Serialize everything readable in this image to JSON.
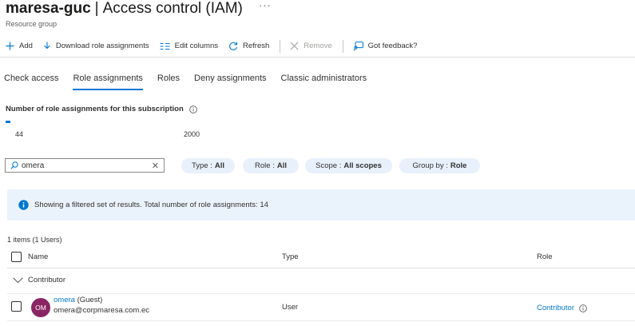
{
  "header": {
    "resource_name": "maresa-guc",
    "separator": "|",
    "page_title": "Access control (IAM)",
    "more_label": "···",
    "subtitle": "Resource group"
  },
  "toolbar": {
    "add_label": "Add",
    "download_label": "Download role assignments",
    "edit_columns_label": "Edit columns",
    "refresh_label": "Refresh",
    "remove_label": "Remove",
    "feedback_label": "Got feedback?"
  },
  "tabs": [
    {
      "label": "Check access",
      "active": false
    },
    {
      "label": "Role assignments",
      "active": true
    },
    {
      "label": "Roles",
      "active": false
    },
    {
      "label": "Deny assignments",
      "active": false
    },
    {
      "label": "Classic administrators",
      "active": false
    }
  ],
  "assignment_count": {
    "title": "Number of role assignments for this subscription",
    "current": "44",
    "limit": "2000",
    "fraction": 0.022
  },
  "search": {
    "value": "omera",
    "clear_label": "✕"
  },
  "filters": [
    {
      "label": "Type :",
      "value": "All"
    },
    {
      "label": "Role :",
      "value": "All"
    },
    {
      "label": "Scope :",
      "value": "All scopes"
    },
    {
      "label": "Group by :",
      "value": "Role"
    }
  ],
  "banner": {
    "text": "Showing a filtered set of results. Total number of role assignments: 14"
  },
  "table": {
    "items_count": "1 items (1 Users)",
    "columns": {
      "name": "Name",
      "type": "Type",
      "role": "Role"
    },
    "group_label": "Contributor",
    "rows": [
      {
        "initials": "OM",
        "name": "omera",
        "qualifier": "(Guest)",
        "email": "omera@corpmaresa.com.ec",
        "type": "User",
        "role": "Contributor"
      }
    ]
  },
  "colors": {
    "accent": "#0078d4",
    "avatar": "#8a2563",
    "pill_bg": "#e8f0fb",
    "banner_bg": "#eaf3fc"
  },
  "icons": [
    "plus-icon",
    "download-icon",
    "columns-icon",
    "refresh-icon",
    "close-icon",
    "feedback-icon",
    "info-icon",
    "search-icon",
    "chevron-down-icon"
  ]
}
